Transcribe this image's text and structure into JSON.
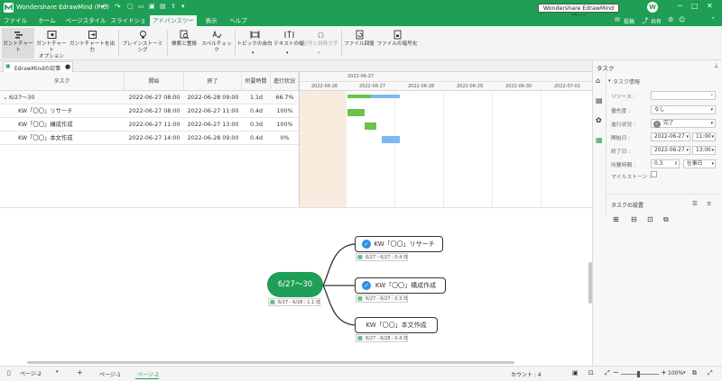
{
  "window": {
    "title": "Wondershare EdrawMind (Pro)",
    "tooltip": "Wondershare EdrawMind (Pro)",
    "avatar_letter": "W",
    "post_label": "投稿",
    "share_label": "共有"
  },
  "menu": [
    "ファイル",
    "ホーム",
    "ページスタイル",
    "スライドショー",
    "アドバンスツール",
    "表示",
    "ヘルプ"
  ],
  "ribbon": {
    "gantt": "ガントチャート",
    "gantt_opt1": "ガントチャート",
    "gantt_opt2": "オプション",
    "gantt_export": "ガントチャートを出力",
    "brainstorm": "ブレインストーミング",
    "find_replace": "検索と置換",
    "spellcheck": "スペルチェック",
    "topic_margin": "トピックの余白",
    "text_width": "テキストの幅",
    "symbols": "記号と特殊文字",
    "file_recover": "ファイル回復",
    "file_encrypt": "ファイルの暗号化"
  },
  "doc_tab": "EdrawMindの記事",
  "gantt": {
    "headers": {
      "task": "タスク",
      "start": "開始",
      "end": "終了",
      "duration": "所要時間",
      "progress": "進行状況"
    },
    "date_top": "2022-06-27",
    "dates": [
      "2022-06-26",
      "2022-06-27",
      "2022-06-28",
      "2022-06-29",
      "2022-06-30",
      "2022-07-01"
    ],
    "rows": [
      {
        "task": "6/27～30",
        "start": "2022-06-27 08:00",
        "end": "2022-06-28 09:00",
        "duration": "1.1d",
        "progress": "66.7%"
      },
      {
        "task": "KW「〇〇」リサーチ",
        "start": "2022-06-27 08:00",
        "end": "2022-06-27 11:00",
        "duration": "0.4d",
        "progress": "100%"
      },
      {
        "task": "KW「〇〇」構成作成",
        "start": "2022-06-27 11:00",
        "end": "2022-06-27 13:00",
        "duration": "0.3d",
        "progress": "100%"
      },
      {
        "task": "KW「〇〇」本文作成",
        "start": "2022-06-27 14:00",
        "end": "2022-06-28 09:00",
        "duration": "0.4d",
        "progress": "0%"
      }
    ]
  },
  "map": {
    "central": "6/27～30",
    "central_meta": "6/27 - 6/28 : 1.1 日",
    "topics": [
      {
        "label": "KW「〇〇」リサーチ",
        "meta": "6/27 - 6/27 : 0.4 日"
      },
      {
        "label": "KW「〇〇」構成作成",
        "meta": "6/27 - 6/27 : 0.3 日"
      },
      {
        "label": "KW「〇〇」本文作成",
        "meta": "6/27 - 6/28 : 0.4 日"
      }
    ]
  },
  "panel": {
    "title": "タスク",
    "section": "タスク情報",
    "resource_label": "リソース :",
    "priority_label": "優先度 :",
    "priority_value": "なし",
    "progress_label": "進行状況 :",
    "progress_value": "完了",
    "start_label": "開始日 :",
    "start_date": "2022-06-27",
    "start_time": "11:00",
    "end_label": "終了日 :",
    "end_date": "2022-06-27",
    "end_time": "13:00",
    "duration_label": "所要時間 :",
    "duration_value": "0.3",
    "duration_unit": "仕事日",
    "milestone_label": "マイルストーン :",
    "settings_title": "タスクの設置"
  },
  "status": {
    "page_select": "ページ-2",
    "page1": "ページ-1",
    "page2": "ページ-2",
    "count": "カウント : 4",
    "zoom": "100%"
  },
  "colors": {
    "brand": "#1f9e55",
    "bar_done": "#6cc24a",
    "bar_todo": "#7fb8f0"
  }
}
